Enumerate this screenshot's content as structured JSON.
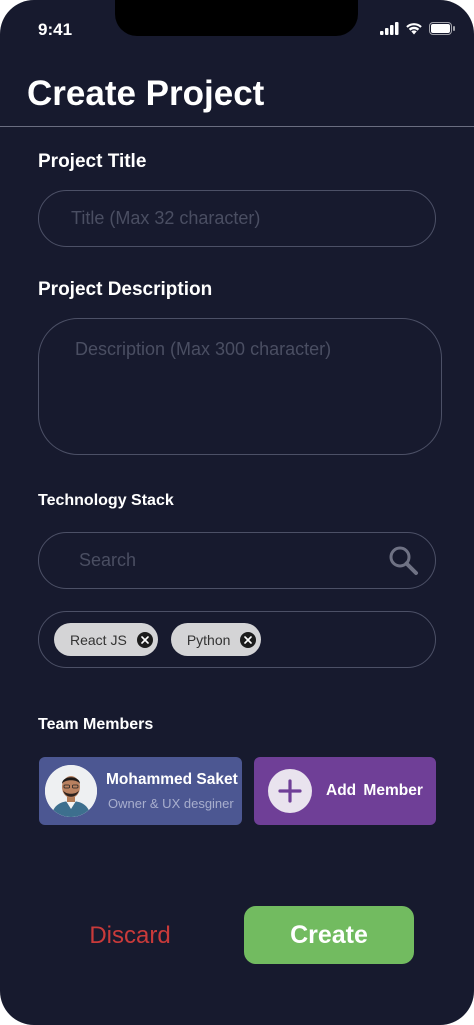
{
  "status_bar": {
    "time": "9:41",
    "icons": [
      "cellular-signal-icon",
      "wifi-icon",
      "battery-icon"
    ]
  },
  "header": {
    "title": "Create Project"
  },
  "form": {
    "title_label": "Project Title",
    "title_placeholder": "Title (Max 32 character)",
    "description_label": "Project Description",
    "description_placeholder": "Description (Max 300 character)",
    "tech_label": "Technology Stack",
    "search_placeholder": "Search",
    "tech_chips": [
      {
        "label": "React JS"
      },
      {
        "label": "Python"
      }
    ],
    "team_label": "Team Members",
    "members": [
      {
        "name": "Mohammed Saket",
        "role": "Owner & UX desginer"
      }
    ],
    "add_member_label": "Add  Member"
  },
  "actions": {
    "discard_label": "Discard",
    "create_label": "Create"
  },
  "colors": {
    "background": "#171a2e",
    "member_card": "#4c5792",
    "add_member": "#6f3f97",
    "discard": "#c93a3a",
    "create": "#72bb60"
  }
}
